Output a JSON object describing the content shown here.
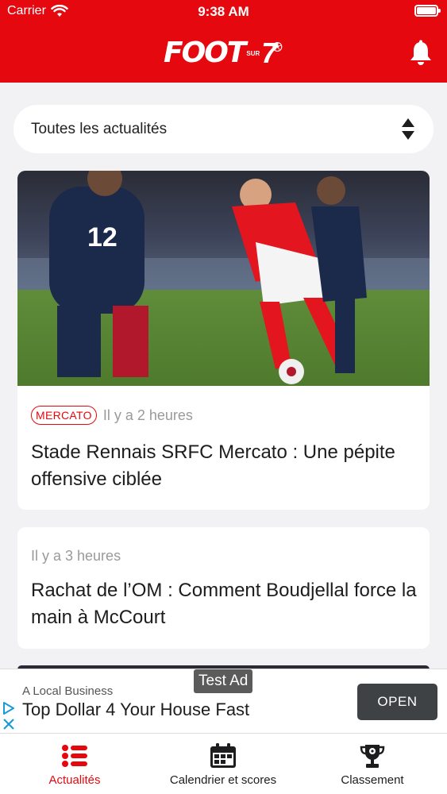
{
  "status_bar": {
    "carrier": "Carrier",
    "time": "9:38 AM"
  },
  "header": {
    "logo_main": "FOOT",
    "logo_small": "SUR",
    "logo_number": "7",
    "bell_icon": "bell-icon"
  },
  "filter": {
    "selected": "Toutes les actualités"
  },
  "articles": [
    {
      "tag": "MERCATO",
      "time_ago": "Il y a 2 heures",
      "title": "Stade Rennais SRFC Mercato : Une pépite offensive ciblée",
      "has_image": true
    },
    {
      "time_ago": "Il y a 3 heures",
      "title": "Rachat de l’OM : Comment Boudjellal force la main à McCourt",
      "has_image": false
    }
  ],
  "ad": {
    "badge": "Test Ad",
    "advertiser": "A Local Business",
    "headline": "Top Dollar 4 Your House Fast",
    "cta": "OPEN"
  },
  "tabbar": {
    "items": [
      {
        "label": "Actualités",
        "icon": "list-icon",
        "active": true
      },
      {
        "label": "Calendrier et scores",
        "icon": "calendar-icon",
        "active": false
      },
      {
        "label": "Classement",
        "icon": "trophy-icon",
        "active": false
      }
    ]
  },
  "colors": {
    "brand_red": "#e5080f",
    "background": "#f2f2f4",
    "text": "#1d1d1f",
    "muted": "#9a9a9a"
  }
}
